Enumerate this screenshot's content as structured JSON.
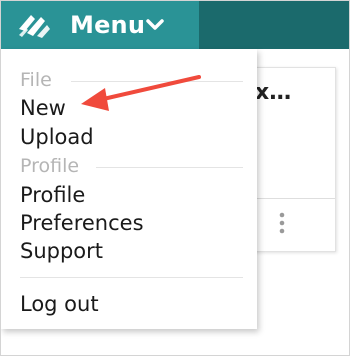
{
  "header": {
    "menu_label": "Menu",
    "logo_icon": "logo-icon",
    "chevron_icon": "chevron-down-icon",
    "accent_color": "#2a9396"
  },
  "dropdown": {
    "file_section": "File",
    "new": "New",
    "upload": "Upload",
    "profile_section": "Profile",
    "profile": "Profile",
    "preferences": "Preferences",
    "support": "Support",
    "logout": "Log out"
  },
  "card": {
    "title_partial": "x…",
    "more_icon": "more-vertical-icon"
  },
  "annotation": {
    "arrow_color": "#f04a3c",
    "arrow_icon": "annotation-arrow-icon"
  }
}
